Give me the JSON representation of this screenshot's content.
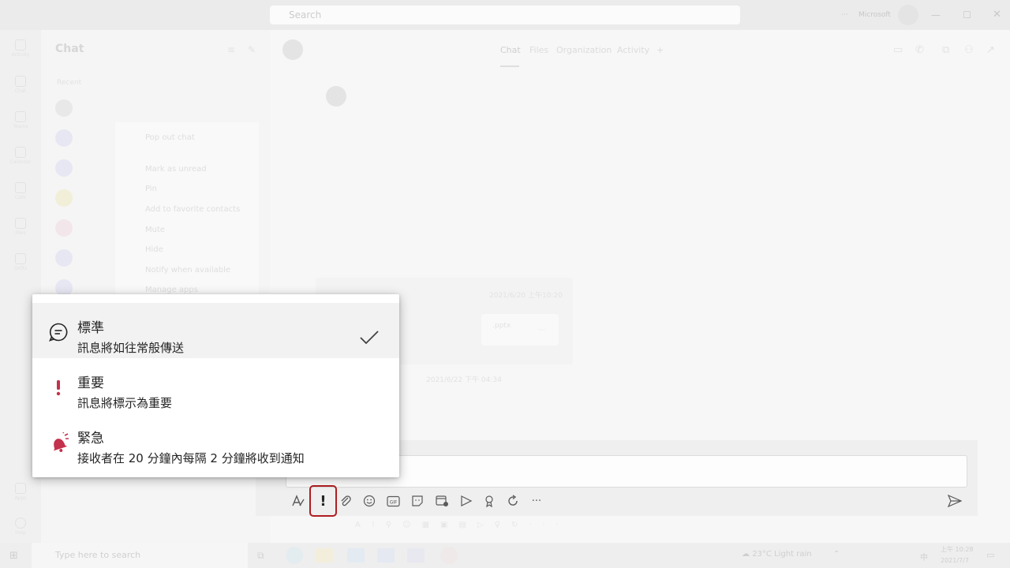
{
  "titlebar": {
    "search_placeholder": "Search",
    "org_name": "Microsoft"
  },
  "rail": {
    "items": [
      "Activity",
      "Chat",
      "Teams",
      "Calendar",
      "Calls",
      "Files",
      "OKRs",
      "Apps",
      "Help"
    ]
  },
  "chatlist": {
    "title": "Chat",
    "section": "Recent",
    "context_menu": [
      "Pop out chat",
      "Mark as unread",
      "Pin",
      "Add to favorite contacts",
      "Mute",
      "Hide",
      "Notify when available",
      "Manage apps"
    ]
  },
  "conversation": {
    "tabs": [
      "Chat",
      "Files",
      "Organization",
      "Activity"
    ],
    "message_timestamp": "2021/6/20 上午10:20",
    "attachment_name": ".pptx",
    "second_timestamp": "2021/6/22 下午 04:34"
  },
  "priority_menu": {
    "options": [
      {
        "title": "標準",
        "description": "訊息將如往常般傳送",
        "icon": "chat-bubble-icon",
        "selected": true
      },
      {
        "title": "重要",
        "description": "訊息將標示為重要",
        "icon": "exclamation-icon",
        "selected": false
      },
      {
        "title": "緊急",
        "description": "接收者在 20 分鐘內每隔 2 分鐘將收到通知",
        "icon": "bell-urgent-icon",
        "selected": false
      }
    ]
  },
  "compose": {
    "priority_button_label": "!",
    "more_label": "···"
  },
  "taskbar": {
    "search_placeholder": "Type here to search",
    "weather": "23°C  Light rain",
    "ime": "中",
    "time": "上午 10:28",
    "date": "2021/7/7"
  },
  "colors": {
    "priority_highlight": "#b01d22",
    "important_red": "#c4314b",
    "urgent_red": "#c4314b"
  }
}
